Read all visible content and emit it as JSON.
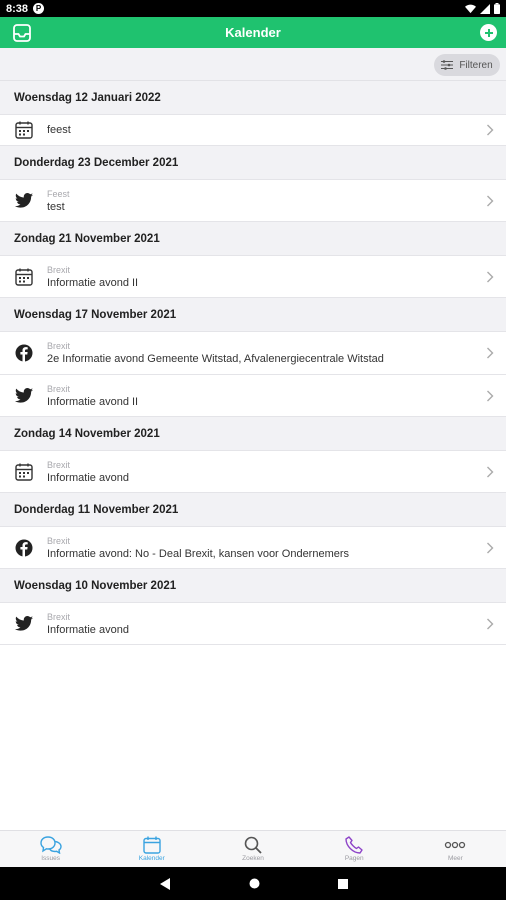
{
  "status": {
    "time": "8:38",
    "app_letter": "P"
  },
  "header": {
    "title": "Kalender"
  },
  "toolbar": {
    "filter_label": "Filteren"
  },
  "sections": [
    {
      "date": "Woensdag 12 Januari 2022",
      "items": [
        {
          "icon": "calendar",
          "subtitle": "",
          "title": "feest"
        }
      ]
    },
    {
      "date": "Donderdag 23 December 2021",
      "items": [
        {
          "icon": "twitter",
          "subtitle": "Feest",
          "title": "test"
        }
      ]
    },
    {
      "date": "Zondag 21 November 2021",
      "items": [
        {
          "icon": "calendar",
          "subtitle": "Brexit",
          "title": "Informatie avond II"
        }
      ]
    },
    {
      "date": "Woensdag 17 November 2021",
      "items": [
        {
          "icon": "facebook",
          "subtitle": "Brexit",
          "title": "2e Informatie avond Gemeente Witstad, Afvalenergiecentrale Witstad"
        },
        {
          "icon": "twitter",
          "subtitle": "Brexit",
          "title": "Informatie avond II"
        }
      ]
    },
    {
      "date": "Zondag 14 November 2021",
      "items": [
        {
          "icon": "calendar",
          "subtitle": "Brexit",
          "title": "Informatie avond"
        }
      ]
    },
    {
      "date": "Donderdag 11 November 2021",
      "items": [
        {
          "icon": "facebook",
          "subtitle": "Brexit",
          "title": "Informatie avond: No - Deal Brexit, kansen voor Ondernemers"
        }
      ]
    },
    {
      "date": "Woensdag 10 November 2021",
      "items": [
        {
          "icon": "twitter",
          "subtitle": "Brexit",
          "title": "Informatie avond"
        }
      ]
    }
  ],
  "nav": [
    {
      "key": "issues",
      "label": "Issues",
      "active": false
    },
    {
      "key": "kalender",
      "label": "Kalender",
      "active": true
    },
    {
      "key": "zoeken",
      "label": "Zoeken",
      "active": false
    },
    {
      "key": "pagen",
      "label": "Pagen",
      "active": false
    },
    {
      "key": "meer",
      "label": "Meer",
      "active": false
    }
  ],
  "colors": {
    "brand": "#1fc26f",
    "active_nav": "#3aa3e0",
    "pagen_icon": "#8e44c8"
  }
}
